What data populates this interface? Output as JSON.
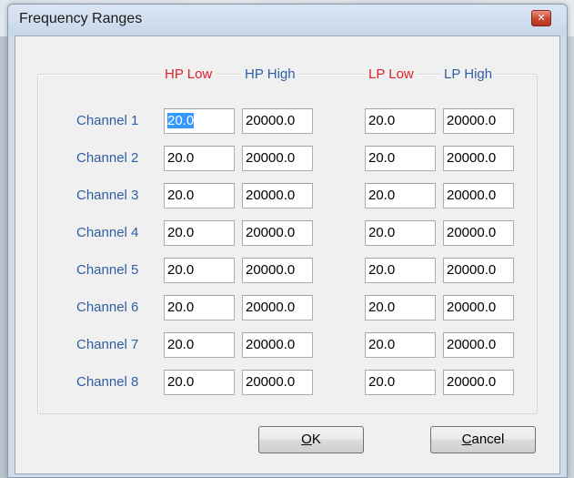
{
  "dialog": {
    "title": "Frequency Ranges",
    "close_glyph": "✕"
  },
  "columns": [
    {
      "label": "HP Low",
      "color": "#e0202a"
    },
    {
      "label": "HP High",
      "color": "#2f5fa2"
    },
    {
      "label": "LP Low",
      "color": "#e0202a"
    },
    {
      "label": "LP High",
      "color": "#2f5fa2"
    }
  ],
  "channels": [
    {
      "label": "Channel 1",
      "hp_low": "20.0",
      "hp_high": "20000.0",
      "lp_low": "20.0",
      "lp_high": "20000.0"
    },
    {
      "label": "Channel 2",
      "hp_low": "20.0",
      "hp_high": "20000.0",
      "lp_low": "20.0",
      "lp_high": "20000.0"
    },
    {
      "label": "Channel 3",
      "hp_low": "20.0",
      "hp_high": "20000.0",
      "lp_low": "20.0",
      "lp_high": "20000.0"
    },
    {
      "label": "Channel 4",
      "hp_low": "20.0",
      "hp_high": "20000.0",
      "lp_low": "20.0",
      "lp_high": "20000.0"
    },
    {
      "label": "Channel 5",
      "hp_low": "20.0",
      "hp_high": "20000.0",
      "lp_low": "20.0",
      "lp_high": "20000.0"
    },
    {
      "label": "Channel 6",
      "hp_low": "20.0",
      "hp_high": "20000.0",
      "lp_low": "20.0",
      "lp_high": "20000.0"
    },
    {
      "label": "Channel 7",
      "hp_low": "20.0",
      "hp_high": "20000.0",
      "lp_low": "20.0",
      "lp_high": "20000.0"
    },
    {
      "label": "Channel 8",
      "hp_low": "20.0",
      "hp_high": "20000.0",
      "lp_low": "20.0",
      "lp_high": "20000.0"
    }
  ],
  "buttons": {
    "ok_mnemonic": "O",
    "ok_rest": "K",
    "cancel_mnemonic": "C",
    "cancel_rest": "ancel"
  },
  "colors": {
    "hp_low_label": "#e0202a",
    "lp_low_label": "#e0202a",
    "high_label": "#2f5fa2",
    "channel_label": "#2f5fa2",
    "selection": "#3399ff"
  },
  "icons": {
    "close": "close-icon"
  }
}
